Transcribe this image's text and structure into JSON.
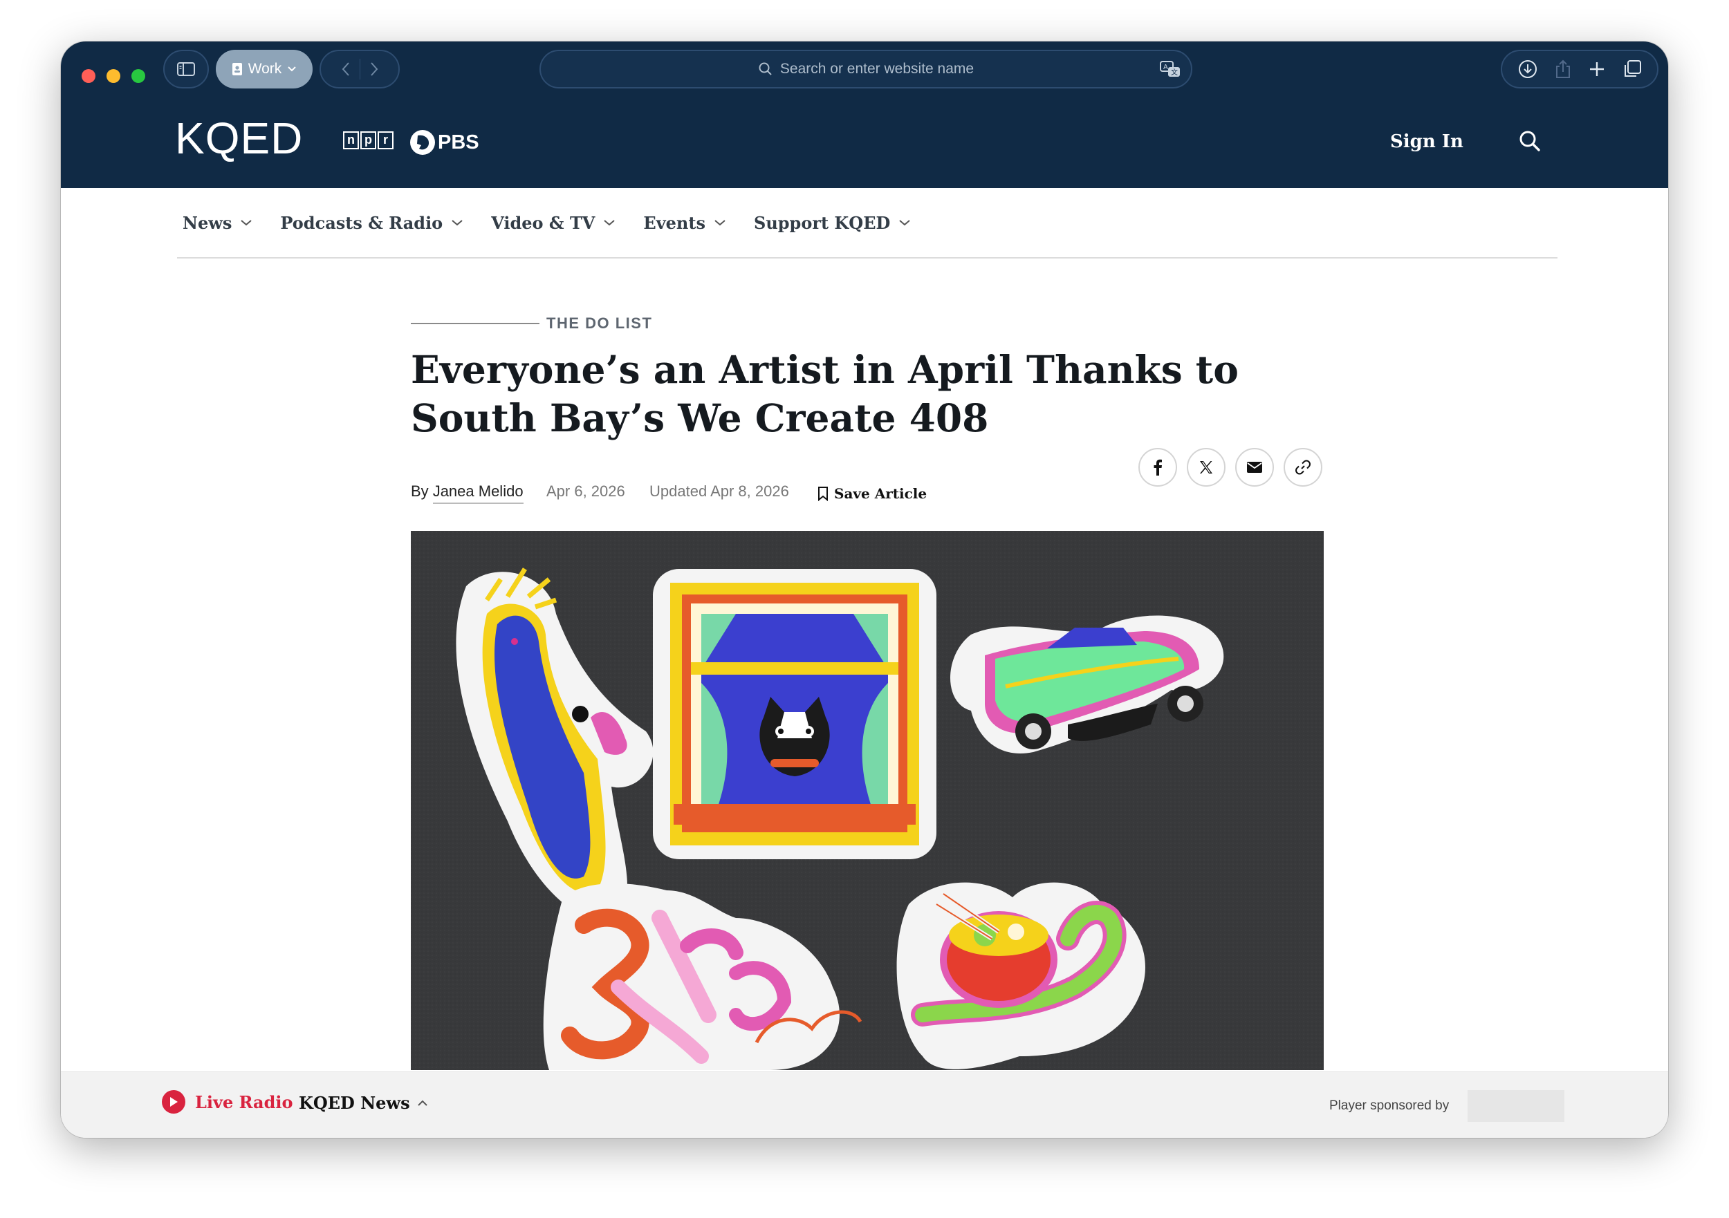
{
  "browser": {
    "profile_label": "Work",
    "address_placeholder": "Search or enter website name"
  },
  "site": {
    "logo_text": "KQED",
    "partner_npr": [
      "n",
      "p",
      "r"
    ],
    "partner_pbs": "PBS",
    "sign_in_label": "Sign In"
  },
  "nav": {
    "items": [
      {
        "label": "News"
      },
      {
        "label": "Podcasts & Radio"
      },
      {
        "label": "Video & TV"
      },
      {
        "label": "Events"
      },
      {
        "label": "Support KQED"
      }
    ]
  },
  "article": {
    "kicker": "THE DO LIST",
    "headline": "Everyone’s an Artist in April Thanks to South Bay’s We Create 408",
    "byline_prefix": "By",
    "author": "Janea Melido",
    "published": "Apr 6, 2026",
    "updated": "Updated Apr 8, 2026",
    "save_label": "Save Article",
    "share_icons": [
      "facebook-icon",
      "x-icon",
      "email-icon",
      "link-icon"
    ]
  },
  "player": {
    "live_label": "Live Radio",
    "station": "KQED News",
    "sponsor_label": "Player sponsored by"
  },
  "colors": {
    "header_bg": "#102a45",
    "accent_red": "#d9233f",
    "hero_bg": "#3a3b3d"
  }
}
